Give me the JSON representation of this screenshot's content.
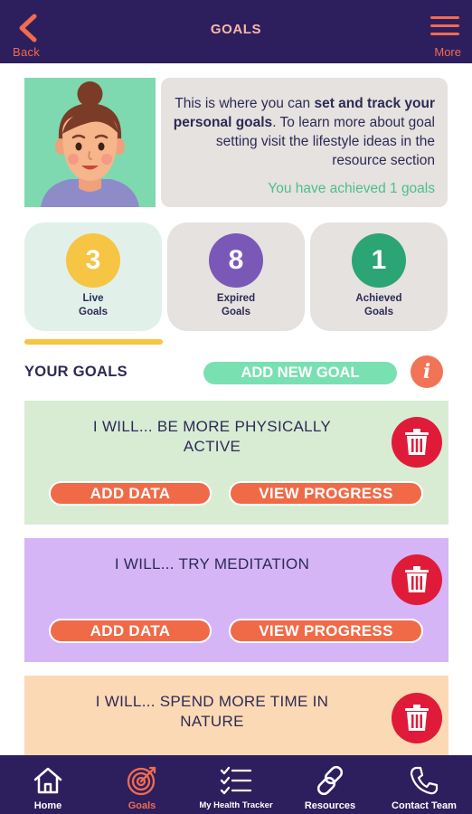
{
  "header": {
    "back_label": "Back",
    "title": "GOALS",
    "more_label": "More"
  },
  "intro": {
    "text_pre": "This is where you can ",
    "text_bold": "set and track your personal goals",
    "text_post": ". To learn more about goal setting visit the lifestyle ideas in the resource section",
    "achieved_note": "You have achieved 1 goals"
  },
  "stats": [
    {
      "count": "3",
      "label_line1": "Live",
      "label_line2": "Goals",
      "color": "#f5c543"
    },
    {
      "count": "8",
      "label_line1": "Expired",
      "label_line2": "Goals",
      "color": "#7a58b8"
    },
    {
      "count": "1",
      "label_line1": "Achieved",
      "label_line2": "Goals",
      "color": "#2aa573"
    }
  ],
  "goals_section": {
    "heading": "YOUR GOALS",
    "add_button": "ADD NEW GOAL",
    "info_button": "i"
  },
  "goals": [
    {
      "line1": "I WILL... BE MORE PHYSICALLY",
      "line2": "ACTIVE",
      "add_data": "ADD DATA",
      "view_progress": "VIEW PROGRESS",
      "bg": "#d8ecd4"
    },
    {
      "line1": "I WILL... TRY MEDITATION",
      "line2": "",
      "add_data": "ADD DATA",
      "view_progress": "VIEW PROGRESS",
      "bg": "#d6b5f7"
    },
    {
      "line1": "I WILL... SPEND MORE TIME IN",
      "line2": "NATURE",
      "bg": "#fcd9b5"
    }
  ],
  "nav": {
    "items": [
      {
        "label": "Home",
        "icon": "home-icon"
      },
      {
        "label": "Goals",
        "icon": "target-icon"
      },
      {
        "label": "My Health Tracker",
        "icon": "checklist-icon"
      },
      {
        "label": "Resources",
        "icon": "link-icon"
      },
      {
        "label": "Contact Team",
        "icon": "phone-icon"
      }
    ],
    "active_index": 1
  },
  "colors": {
    "header_bg": "#2d1f5e",
    "accent_orange": "#f26b4f",
    "mint": "#79e0b2",
    "trash_red": "#e01b3a"
  }
}
